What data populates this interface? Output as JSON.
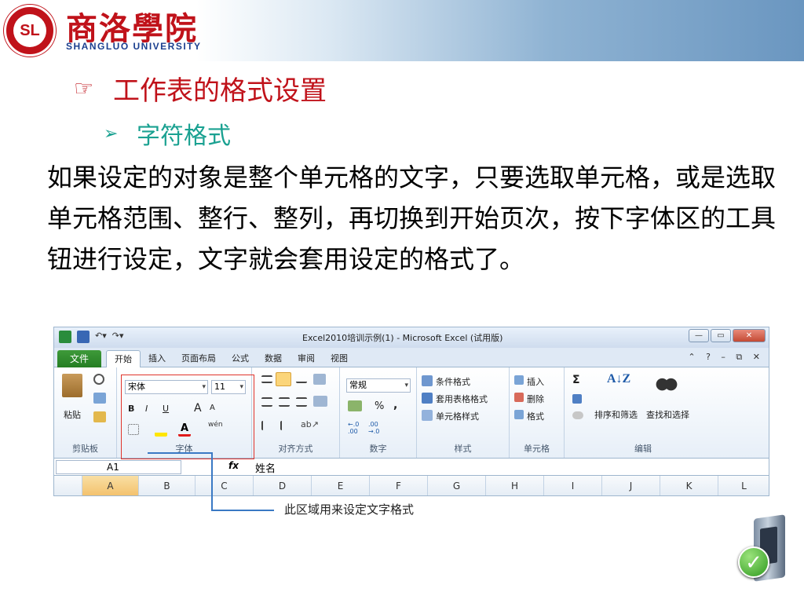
{
  "header": {
    "logo_cn": "商洛學院",
    "logo_en": "SHANGLUO UNIVERSITY",
    "seal_text": "SL"
  },
  "title": {
    "bullet": "☞",
    "text": "工作表的格式设置"
  },
  "subtitle": {
    "bullet": "➢",
    "text": "字符格式"
  },
  "body_text": "如果设定的对象是整个单元格的文字，只要选取单元格，或是选取单元格范围、整行、整列，再切换到开始页次，按下字体区的工具钮进行设定，文字就会套用设定的格式了。",
  "excel": {
    "window_title": "Excel2010培训示例(1) - Microsoft Excel (试用版)",
    "file_tab": "文件",
    "tabs": [
      "开始",
      "插入",
      "页面布局",
      "公式",
      "数据",
      "审阅",
      "视图"
    ],
    "clipboard": {
      "paste": "粘贴",
      "label": "剪贴板"
    },
    "font": {
      "name": "宋体",
      "size": "11",
      "label": "字体",
      "bold": "B",
      "italic": "I",
      "underline": "U",
      "grow": "A",
      "shrink": "A",
      "wen": "wén"
    },
    "alignment": {
      "label": "对齐方式"
    },
    "number": {
      "format": "常规",
      "label": "数字",
      "percent": "%",
      "comma": ",",
      "inc": "+.0\n.00",
      "dec": ".00\n→.0"
    },
    "styles": {
      "items": [
        "条件格式",
        "套用表格格式",
        "单元格样式"
      ],
      "label": "样式"
    },
    "cells": {
      "items": [
        "插入",
        "删除",
        "格式"
      ],
      "label": "单元格"
    },
    "editing": {
      "sigma": "Σ",
      "sort": "排序和筛选",
      "find": "查找和选择",
      "label": "编辑"
    },
    "name_box": "A1",
    "fx": "fx",
    "formula_value": "姓名",
    "columns": [
      "A",
      "B",
      "C",
      "D",
      "E",
      "F",
      "G",
      "H",
      "I",
      "J",
      "K",
      "L"
    ]
  },
  "callout": "此区域用来设定文字格式",
  "colors": {
    "title": "#c0121a",
    "subtitle": "#1aa191",
    "highlight": "#e0332b",
    "callout_line": "#3a79c4"
  },
  "icons": [
    "seal-logo-icon",
    "hand-pointer-icon",
    "arrow-bullet-icon",
    "server-icon",
    "checkmark-icon"
  ]
}
